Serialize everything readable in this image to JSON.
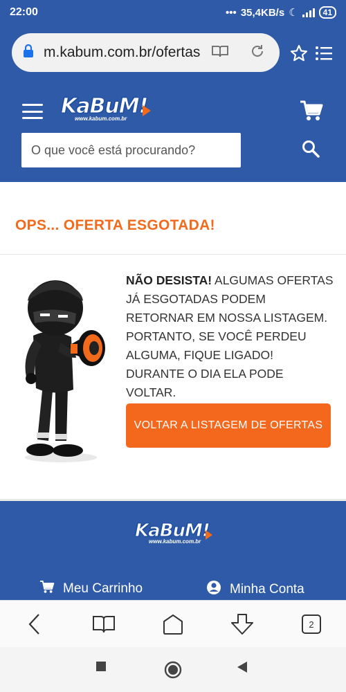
{
  "status_bar": {
    "time": "22:00",
    "network_speed": "35,4KB/s",
    "battery": "41"
  },
  "browser": {
    "url": "m.kabum.com.br/ofertas",
    "tab_count": "2"
  },
  "header": {
    "logo_text": "KaBuM!",
    "logo_url": "www.kabum.com.br",
    "search_placeholder": "O que você está procurando?"
  },
  "main": {
    "title": "OPS... OFERTA ESGOTADA!",
    "message_bold": "NÃO DESISTA!",
    "message_rest": " ALGUMAS OFERTAS JÁ ESGOTADAS PODEM RETORNAR EM NOSSA LISTAGEM. PORTANTO, SE VOCÊ PERDEU ALGUMA, FIQUE LIGADO! DURANTE O DIA ELA PODE VOLTAR.",
    "button_label": "VOLTAR A LISTAGEM DE OFERTAS"
  },
  "footer": {
    "logo_text": "KaBuM!",
    "logo_url": "www.kabum.com.br",
    "cart_label": "Meu Carrinho",
    "account_label": "Minha Conta"
  },
  "colors": {
    "brand_blue": "#2e5aa8",
    "accent_orange": "#f26a1b"
  }
}
